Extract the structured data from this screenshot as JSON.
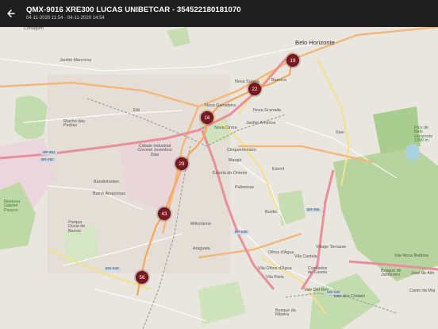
{
  "appbar": {
    "title": "QMX-9016 XRE300 LUCAS UNIBETCAR - 354522180181070",
    "subtitle": "04-11-2020 11:54 - 04-11-2020 14:54",
    "back_icon": "arrow-left-icon"
  },
  "map": {
    "labels": {
      "contagem": "Contagem",
      "jardim_marrocos": "Jardim Marrocos",
      "riacho": "Riacho das Pedras",
      "cidade_industrial": "Cidade Industrial Coronel Juventino Dias",
      "bandeirantes": "Bandeirantes",
      "bairro_amazonas": "Bairro Amazonas",
      "reserva": "Reserva Gabriel Passos",
      "parque_duval": "Parque Duval de Barros",
      "eldorado": "Eld",
      "nova_gameleira": "Nova Gameleira",
      "nova_cintra": "Nova Cintra",
      "nova_suissa": "Nova Suíssa",
      "barroca": "Barroca",
      "nova_granada": "Nova Granada",
      "jardim_america": "Jardim América",
      "cinquentenario": "Cinquentenário",
      "marajo": "Marajó",
      "estrela": "Estrela do Oriente",
      "palmeiras": "Palmeiras",
      "estoril": "Estoril",
      "belo_horizonte": "Belo Horizonte",
      "sion": "Sion",
      "buritis": "Buritis",
      "milionarios": "Milionários",
      "araguaia": "Araguaia",
      "olhos_dagua": "Olhos d'Água",
      "vila_olhos": "Vila Olhos d'Água",
      "vila_paris": "Vila Paris",
      "vila_castela": "Vila Castela",
      "condados": "Condados de Casela",
      "village_terrasse": "Village Terrasse",
      "vale_del_rey": "Vale Del Rey",
      "vale_cristais": "Vale dos Cristais",
      "bosque": "Bosque da Ribeira",
      "vila_nova_betania": "Vila Nova Betânia",
      "pico_bh": "Pico de Belo Horizonte 1390 m",
      "jose_de_alm": "José de Alm",
      "canto_da_maj": "Canto da Maj",
      "bosque_jambreiro": "Bosque do Jambreiro",
      "br381": "BR-381",
      "br262": "BR-262",
      "br040": "BR-040",
      "mg030": "MG-030",
      "mg040": "MG-040",
      "br356": "BR-356"
    },
    "markers": [
      {
        "label": "19"
      },
      {
        "label": "22"
      },
      {
        "label": "16"
      },
      {
        "label": "29"
      },
      {
        "label": "43"
      },
      {
        "label": "56"
      }
    ],
    "colors": {
      "marker": "#7a1b22",
      "route": "#f2a85e",
      "motorway": "#e88f9b",
      "park": "#bcd9a8"
    }
  }
}
